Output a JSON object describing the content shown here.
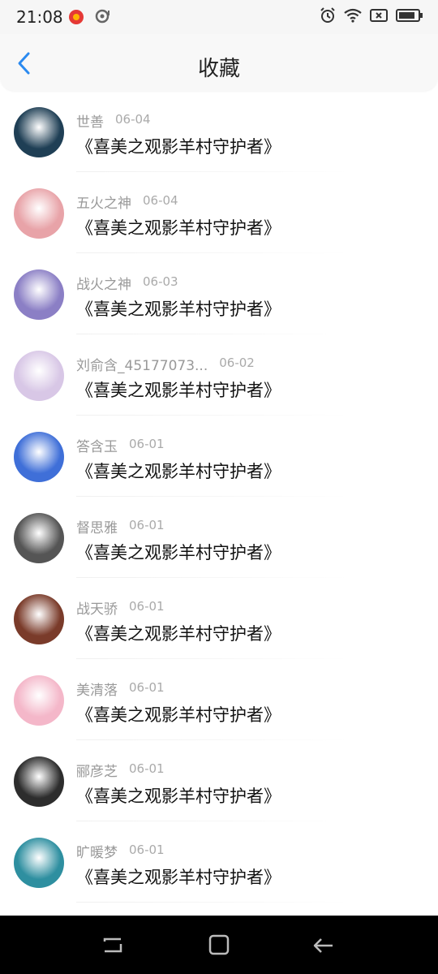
{
  "status_bar": {
    "time": "21:08",
    "icons": [
      "app-notification-icon",
      "settings-notification-icon",
      "alarm-icon",
      "wifi-icon",
      "no-sim-icon",
      "battery-icon"
    ]
  },
  "header": {
    "title": "收藏",
    "back_icon": "chevron-left-icon",
    "accent_color": "#2b8af0"
  },
  "items": [
    {
      "name": "世善",
      "date": "06-04",
      "title": "《喜美之观影羊村守护者》",
      "avatar_color": "#1f3f55"
    },
    {
      "name": "五火之神",
      "date": "06-04",
      "title": "《喜美之观影羊村守护者》",
      "avatar_color": "#e8a3a8"
    },
    {
      "name": "战火之神",
      "date": "06-03",
      "title": "《喜美之观影羊村守护者》",
      "avatar_color": "#8b7fc5"
    },
    {
      "name": "刘俞含_45177073...",
      "date": "06-02",
      "title": "《喜美之观影羊村守护者》",
      "avatar_color": "#d8c7e6"
    },
    {
      "name": "答含玉",
      "date": "06-01",
      "title": "《喜美之观影羊村守护者》",
      "avatar_color": "#3f6fd8"
    },
    {
      "name": "督思雅",
      "date": "06-01",
      "title": "《喜美之观影羊村守护者》",
      "avatar_color": "#555555"
    },
    {
      "name": "战天骄",
      "date": "06-01",
      "title": "《喜美之观影羊村守护者》",
      "avatar_color": "#7a3b2a"
    },
    {
      "name": "美清落",
      "date": "06-01",
      "title": "《喜美之观影羊村守护者》",
      "avatar_color": "#f4b7c9"
    },
    {
      "name": "郦彦芝",
      "date": "06-01",
      "title": "《喜美之观影羊村守护者》",
      "avatar_color": "#2d2d2d"
    },
    {
      "name": "旷暖梦",
      "date": "06-01",
      "title": "《喜美之观影羊村守护者》",
      "avatar_color": "#2e8fa0"
    }
  ],
  "nav_bar": {
    "icons": [
      "recent-apps-icon",
      "home-icon",
      "back-icon"
    ]
  }
}
